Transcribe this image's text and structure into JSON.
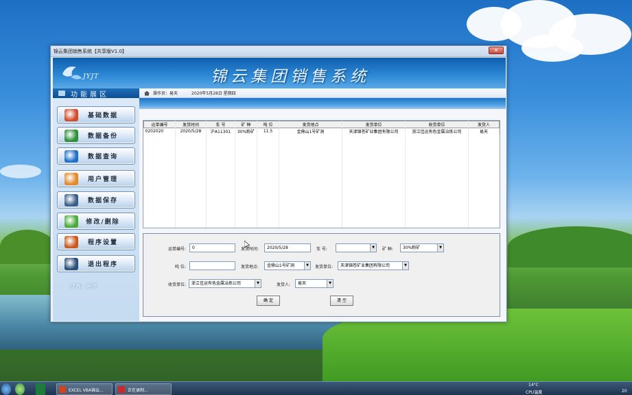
{
  "window": {
    "title": "锦云集团销售系统【共享版V1.0】",
    "close": "✕"
  },
  "banner": {
    "logo_text": "JYJT",
    "app_title": "锦云集团销售系统"
  },
  "side": {
    "header": "功能展区",
    "items": [
      {
        "label": "基础数据",
        "icon": "database-icon",
        "color": "#d24b2a"
      },
      {
        "label": "数据备份",
        "icon": "backup-icon",
        "color": "#2f8f3a"
      },
      {
        "label": "数据查询",
        "icon": "query-icon",
        "color": "#1e70c8"
      },
      {
        "label": "用户管理",
        "icon": "user-icon",
        "color": "#e08a2c"
      },
      {
        "label": "数据保存",
        "icon": "monitor-icon",
        "color": "#3a5f8a"
      },
      {
        "label": "修改/删除",
        "icon": "edit-icon",
        "color": "#4caa3c"
      },
      {
        "label": "程序设置",
        "icon": "settings-user-icon",
        "color": "#c85a20"
      },
      {
        "label": "退出程序",
        "icon": "exit-icon",
        "color": "#2b4f7a"
      }
    ],
    "author": "作者：易天"
  },
  "infobar": {
    "operator": "操作员：易天",
    "date": "2020年5月28日 星期四"
  },
  "grid": {
    "columns": [
      "运单编号",
      "发货时间",
      "车 号",
      "矿 种",
      "吨 位",
      "发货地点",
      "发货单位",
      "收货单位",
      "发货人"
    ],
    "rows": [
      [
        "0202020",
        "2020/5/28",
        "沪A11301",
        "30%粉矿",
        "11.5",
        "金鼎山1号矿洞",
        "天津锦苍矿业集团有限公司",
        "浙江佳运有色金属冶炼公司",
        "易天"
      ]
    ]
  },
  "form": {
    "waybill_label": "运单编号:",
    "waybill_value": "0",
    "time_label": "发货时间:",
    "time_value": "2020/5/28",
    "car_label": "车  号:",
    "car_value": "",
    "ore_label": "矿 种:",
    "ore_value": "30%粉矿",
    "ton_label": "吨 位:",
    "ton_value": "",
    "place_label": "发货地点:",
    "place_value": "金鼎山1号矿洞",
    "sender_unit_label": "发货单位:",
    "sender_unit_value": "天津锦苍矿业集团有限公司",
    "receiver_label": "收货单位:",
    "receiver_value": "浙江佳运有色金属冶炼公司",
    "shipper_label": "发货人:",
    "shipper_value": "易天",
    "confirm": "确 定",
    "clear": "清 空"
  },
  "taskbar": {
    "items": [
      {
        "label": "EXCEL VBA锦云...",
        "icon": "powerpoint-icon",
        "color": "#d04423"
      },
      {
        "label": "正在录制...",
        "icon": "recorder-icon",
        "color": "#c72c2c"
      }
    ],
    "temp": "14°C",
    "cpu": "CPU温度",
    "clock": "20"
  }
}
